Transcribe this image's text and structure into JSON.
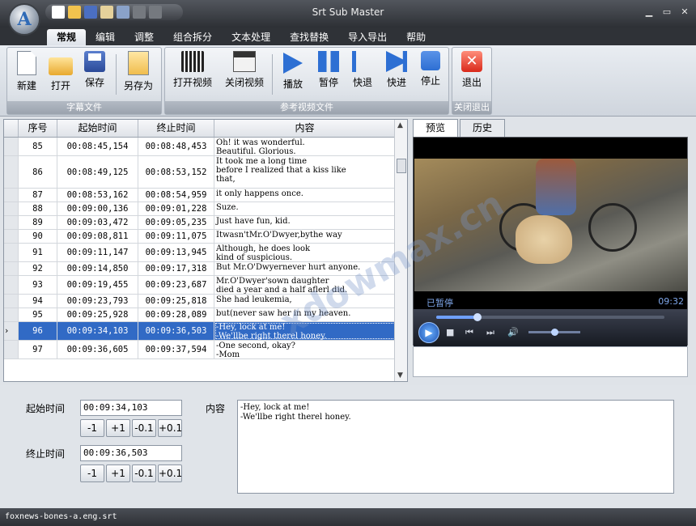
{
  "app": {
    "title": "Srt Sub Master"
  },
  "tabs": [
    "常规",
    "编辑",
    "调整",
    "组合拆分",
    "文本处理",
    "查找替换",
    "导入导出",
    "帮助"
  ],
  "ribbon": {
    "groups": [
      {
        "label": "字幕文件",
        "buttons": [
          "新建",
          "打开",
          "保存",
          "另存为"
        ]
      },
      {
        "label": "参考视频文件",
        "buttons": [
          "打开视频",
          "关闭视频",
          "播放",
          "暂停",
          "快退",
          "快进",
          "停止"
        ]
      },
      {
        "label": "关闭退出",
        "buttons": [
          "退出"
        ]
      }
    ]
  },
  "grid": {
    "headers": [
      "序号",
      "起始时间",
      "终止时间",
      "内容"
    ],
    "rows": [
      {
        "no": "85",
        "start": "00:08:45,154",
        "end": "00:08:48,453",
        "text": "Oh! it was wonderful.\nBeautiful. Glorious."
      },
      {
        "no": "86",
        "start": "00:08:49,125",
        "end": "00:08:53,152",
        "text": "It took me a long time\nbefore I realized that a kiss like\nthat,"
      },
      {
        "no": "87",
        "start": "00:08:53,162",
        "end": "00:08:54,959",
        "text": "it only happens once."
      },
      {
        "no": "88",
        "start": "00:09:00,136",
        "end": "00:09:01,228",
        "text": "Suze."
      },
      {
        "no": "89",
        "start": "00:09:03,472",
        "end": "00:09:05,235",
        "text": "Just have fun, kid."
      },
      {
        "no": "90",
        "start": "00:09:08,811",
        "end": "00:09:11,075",
        "text": "Itwasn'tMr.O'Dwyer,bythe way"
      },
      {
        "no": "91",
        "start": "00:09:11,147",
        "end": "00:09:13,945",
        "text": "Although, he does look\nkind of suspicious."
      },
      {
        "no": "92",
        "start": "00:09:14,850",
        "end": "00:09:17,318",
        "text": "But Mr.O'Dwyernever hurt anyone."
      },
      {
        "no": "93",
        "start": "00:09:19,455",
        "end": "00:09:23,687",
        "text": "Mr.O'Dwyer'sown daughter\ndied a year and a half aflerl did."
      },
      {
        "no": "94",
        "start": "00:09:23,793",
        "end": "00:09:25,818",
        "text": "She had leukemia,"
      },
      {
        "no": "95",
        "start": "00:09:25,928",
        "end": "00:09:28,089",
        "text": "but(never saw her in my heaven."
      },
      {
        "no": "96",
        "start": "00:09:34,103",
        "end": "00:09:36,503",
        "text": "-Hey, lock at me!\n-We'llbe right therel honey."
      },
      {
        "no": "97",
        "start": "00:09:36,605",
        "end": "00:09:37,594",
        "text": "-One second, okay?\n-Mom"
      }
    ]
  },
  "preview": {
    "tabs": [
      "预览",
      "历史"
    ],
    "status": "已暂停",
    "time": "09:32",
    "progress": 0.18,
    "volume": 0.5
  },
  "editor": {
    "start_label": "起始时间",
    "start_value": "00:09:34,103",
    "end_label": "终止时间",
    "end_value": "00:09:36,503",
    "content_label": "内容",
    "content_value": "-Hey, lock at me!\n-We'llbe right therel honey.",
    "steps": [
      "-1",
      "+1",
      "-0.1",
      "+0.1"
    ]
  },
  "status": {
    "file": "foxnews-bones-a.eng.srt"
  },
  "watermark": "xdowmax.cn"
}
